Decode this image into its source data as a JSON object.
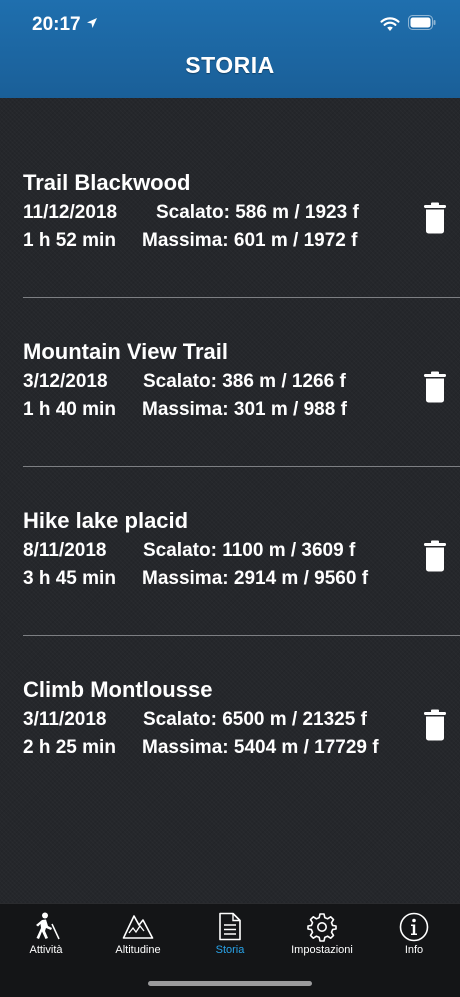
{
  "status_bar": {
    "time": "20:17"
  },
  "header": {
    "title": "STORIA"
  },
  "entries": [
    {
      "name": "Trail Blackwood",
      "date": "11/12/2018",
      "climbed": "Scalato: 586 m / 1923 f",
      "duration": "1 h 52 min",
      "max": "Massima: 601 m / 1972 f"
    },
    {
      "name": "Mountain View Trail",
      "date": "3/12/2018",
      "climbed": "Scalato: 386 m / 1266 f",
      "duration": "1 h 40 min",
      "max": "Massima: 301 m / 988 f"
    },
    {
      "name": "Hike lake placid",
      "date": "8/11/2018",
      "climbed": "Scalato: 1100 m / 3609 f",
      "duration": "3 h 45 min",
      "max": "Massima: 2914 m / 9560 f"
    },
    {
      "name": "Climb Montlousse",
      "date": "3/11/2018",
      "climbed": "Scalato: 6500 m / 21325 f",
      "duration": "2 h 25 min",
      "max": "Massima: 5404 m / 17729 f"
    }
  ],
  "tabs": [
    {
      "label": "Attività",
      "icon": "hiker-icon"
    },
    {
      "label": "Altitudine",
      "icon": "mountain-icon"
    },
    {
      "label": "Storia",
      "icon": "document-icon",
      "active": true
    },
    {
      "label": "Impostazioni",
      "icon": "gear-icon"
    },
    {
      "label": "Info",
      "icon": "info-icon"
    }
  ],
  "colors": {
    "header": "#1f6fae",
    "background": "#26282c",
    "active_tab": "#29a3e8",
    "tabbar": "#141517"
  }
}
